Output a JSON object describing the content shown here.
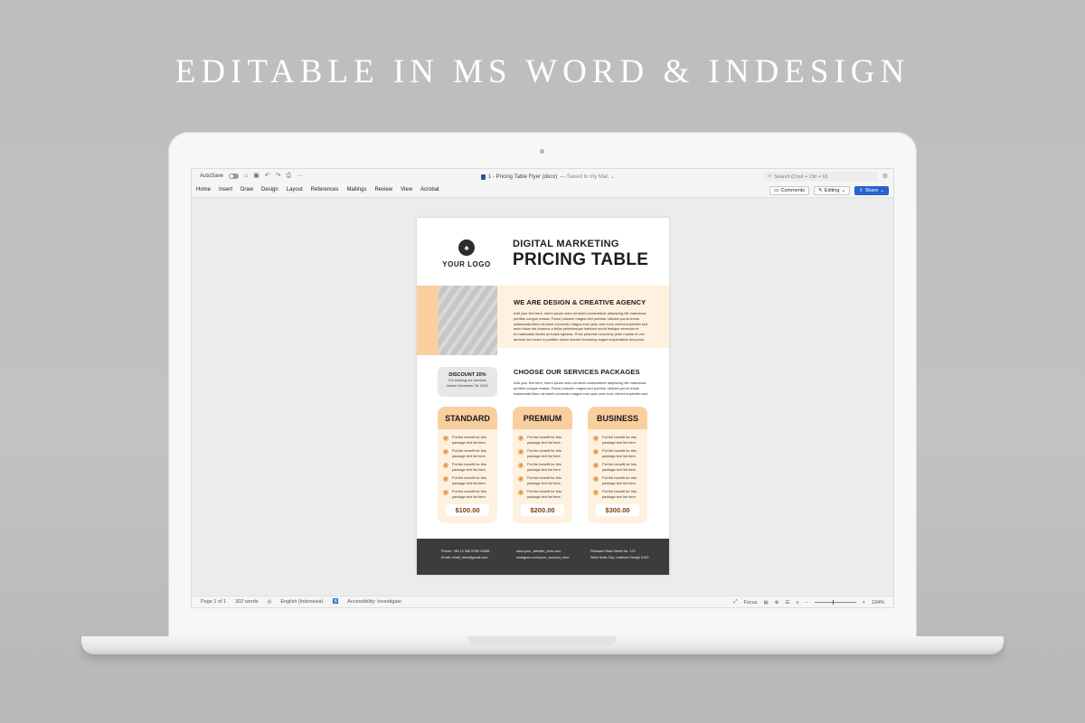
{
  "headline": "EDITABLE IN MS WORD & INDESIGN",
  "word": {
    "titlebar": {
      "autosave_label": "AutoSave",
      "doc_title": "1 - Pricing Table Flyer (docx)",
      "saved_status": "— Saved to my Mac ⌄",
      "search_placeholder": "Search (Cmd + Ctrl + U)",
      "icons": [
        "home-icon",
        "save-icon",
        "undo-icon",
        "redo-icon",
        "print-icon",
        "more-icon",
        "search-icon",
        "settings-icon"
      ]
    },
    "ribbon": {
      "tabs": [
        "Home",
        "Insert",
        "Draw",
        "Design",
        "Layout",
        "References",
        "Mailings",
        "Review",
        "View",
        "Acrobat"
      ],
      "comments_label": "Comments",
      "editing_label": "Editing",
      "share_label": "Share",
      "accent": "#2564cf"
    },
    "statusbar": {
      "page": "Page 1 of 1",
      "words": "302 words",
      "language": "English (Indonesia)",
      "accessibility": "Accessibility: Investigate",
      "focus": "Focus",
      "zoom": "104%"
    }
  },
  "flyer": {
    "logo_text": "YOUR LOGO",
    "subtitle": "DIGITAL MARKETING",
    "title": "PRICING TABLE",
    "agency": {
      "title": "WE ARE DESIGN & CREATIVE AGENCY",
      "lines": [
        "Add your text here, lorem ipsum dolor sit amet consectetuer adipiscing elit maecenas",
        "porttitor congue massa. Fusce posuere magna sed pulvinar ultricies purus lectus",
        "malesuada libero sit amet commodo magna eros quis urna nunc viverra imperdiet sed",
        "enim fusce est vivamus a tellus pellentesque habitant morbi tristique senectus et",
        "et malesuada fames ac turpis egestas. Proin pharetra nonummy pede mauris et orci",
        "aenean nec lorem in porttitor donec laoreet nonummy augue suspendisse dui purus"
      ]
    },
    "discount": {
      "title": "DISCOUNT 20%",
      "line1": "For booking our services",
      "line2": "before December 28, 2024"
    },
    "services": {
      "title": "CHOOSE OUR SERVICES PACKAGES",
      "lines": [
        "Add your text here, lorem ipsum dolor sit amet consectetuer adipiscing elit maecenas",
        "porttitor congue massa. Fusce posuere magna sed pulvinar ultricies purus lectus",
        "malesuada libero sit amet commodo magna eros quis urna nunc viverra imperdiet sed."
      ]
    },
    "benefit_line1": "Put the benefit for this",
    "benefit_line2": "package text list here.",
    "packages": [
      {
        "name": "STANDARD",
        "price": "$100.00"
      },
      {
        "name": "PREMIUM",
        "price": "$200.00"
      },
      {
        "name": "BUSINESS",
        "price": "$300.00"
      }
    ],
    "footer": {
      "phone": "Phone: +88 12 345 6789 10088",
      "email": "Email: email_here@gmail.com",
      "website": "www.your_website_here.com",
      "instagram": "instagram.com/your_account_here",
      "address1": "Pleasant Vista Street No. 170",
      "address2": "West Nulla City, Leaflove Design 5100"
    },
    "colors": {
      "peach": "#f9cf9f",
      "cream": "#fff1df",
      "dark": "#3c3c3c",
      "price": "#7a3f0c"
    }
  }
}
